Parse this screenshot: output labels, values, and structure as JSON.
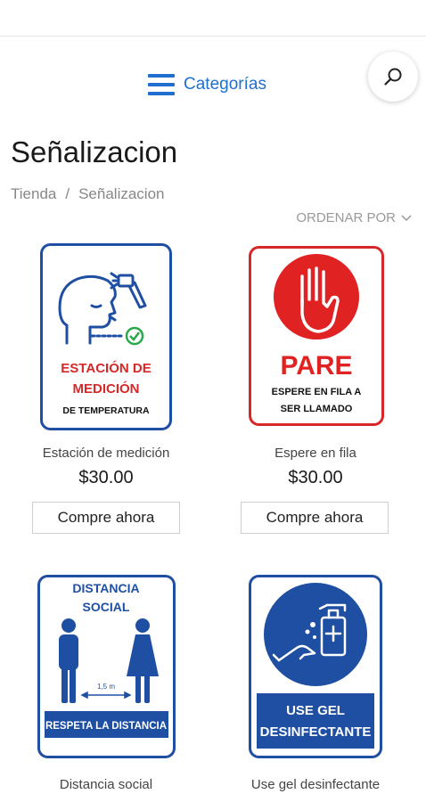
{
  "header": {
    "categories_label": "Categorías",
    "accent_color": "#1e6fcf"
  },
  "page": {
    "title": "Señalizacion",
    "breadcrumb": [
      "Tienda",
      "/",
      "Señalizacion"
    ],
    "sort_label": "ORDENAR POR"
  },
  "products": [
    {
      "name": "Estación de medición",
      "price": "$30.00",
      "button": "Compre ahora",
      "sign_text": [
        "ESTACIÓN DE",
        "MEDICIÓN",
        "DE TEMPERATURA"
      ]
    },
    {
      "name": "Espere en fila",
      "price": "$30.00",
      "button": "Compre ahora",
      "sign_text": [
        "PARE",
        "ESPERE EN FILA A",
        "SER LLAMADO"
      ]
    },
    {
      "name": "Distancia social",
      "sign_text": [
        "DISTANCIA",
        "SOCIAL",
        "1,5 m",
        "RESPETA LA DISTANCIA"
      ]
    },
    {
      "name": "Use gel desinfectante",
      "sign_text": [
        "USE GEL",
        "DESINFECTANTE"
      ]
    }
  ]
}
